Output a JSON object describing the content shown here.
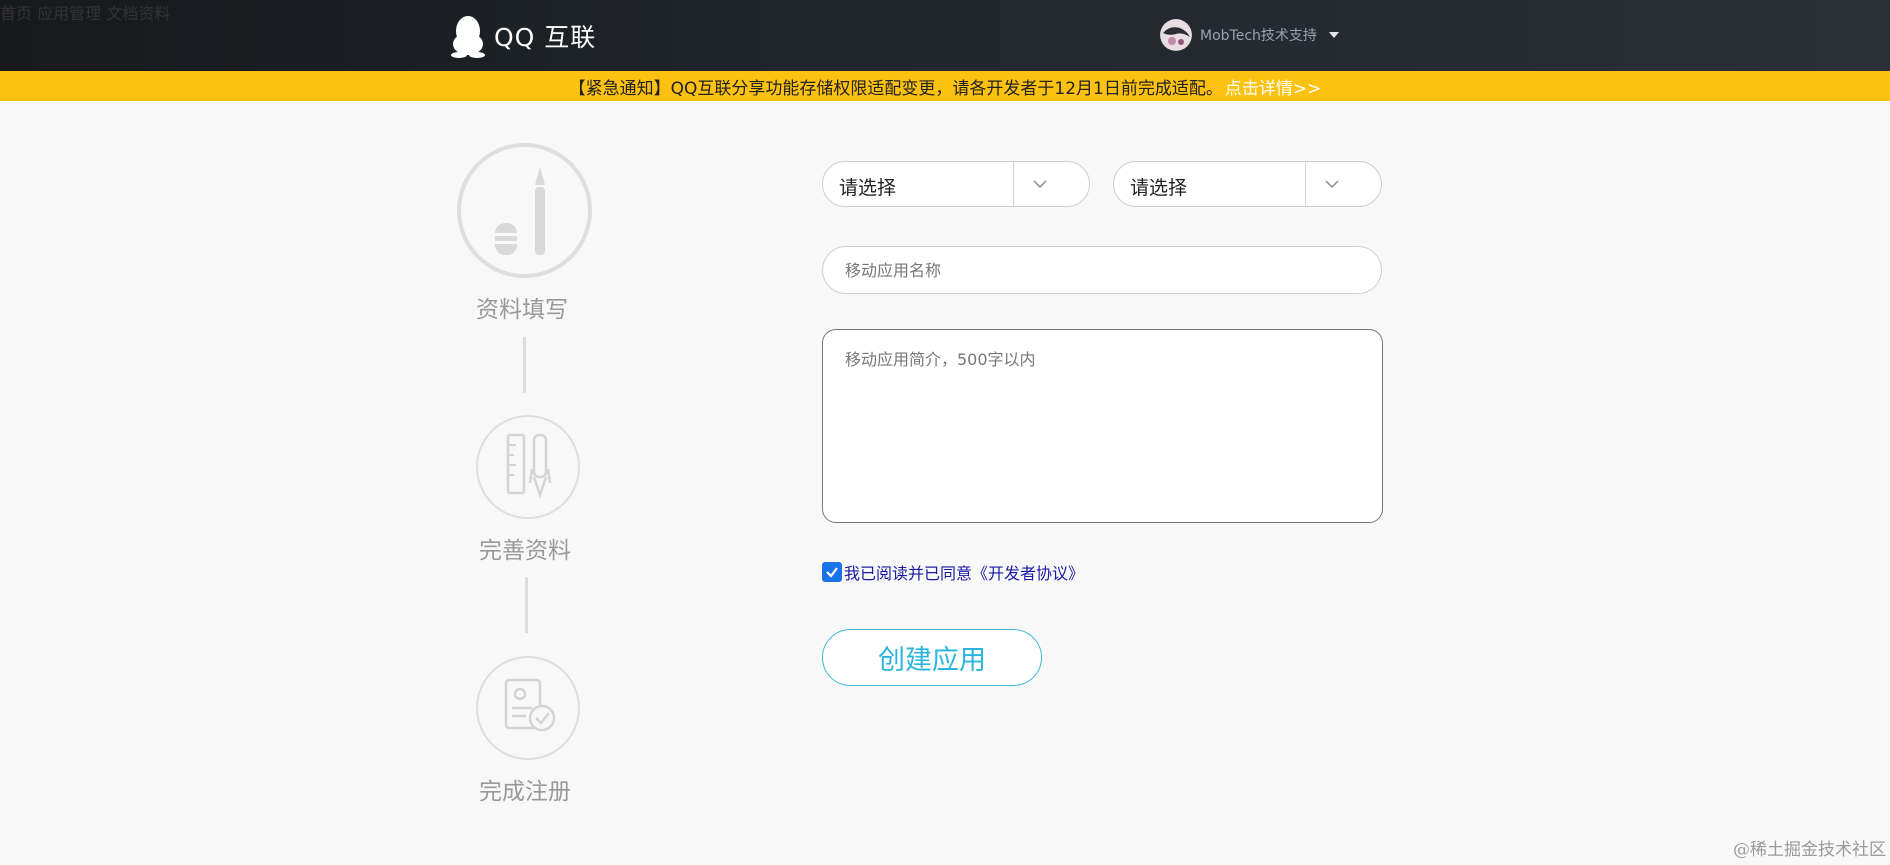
{
  "header": {
    "logo_text": "QQ 互联",
    "nav": [
      "首页",
      "应用管理",
      "文档资料"
    ],
    "user_name": "MobTech技术支持"
  },
  "notice": {
    "text": "【紧急通知】QQ互联分享功能存储权限适配变更，请各开发者于12月1日前完成适配。",
    "link": "点击详情>>"
  },
  "steps": [
    {
      "label": "资料填写",
      "icon": "pen-icon",
      "active": true
    },
    {
      "label": "完善资料",
      "icon": "ruler-pen-icon",
      "active": false
    },
    {
      "label": "完成注册",
      "icon": "document-check-icon",
      "active": false
    }
  ],
  "form": {
    "select1": "请选择",
    "select2": "请选择",
    "name_placeholder": "移动应用名称",
    "desc_placeholder": "移动应用简介，500字以内",
    "agree_text": "我已阅读并已同意《开发者协议》",
    "agree_checked": true,
    "submit_label": "创建应用"
  },
  "watermark": "@稀土掘金技术社区",
  "colors": {
    "header_bg": "#1d2226",
    "notice_bg": "#fcc20f",
    "accent": "#2cb6dd",
    "checkbox": "#1a73e8"
  }
}
